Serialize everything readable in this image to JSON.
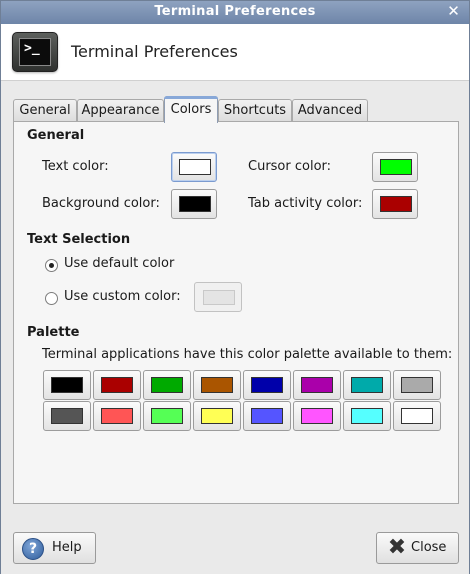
{
  "window": {
    "title": "Terminal Preferences"
  },
  "header": {
    "title": "Terminal Preferences",
    "icon": "terminal-app-icon",
    "prompt": ">_"
  },
  "tabs": [
    {
      "label": "General",
      "active": false
    },
    {
      "label": "Appearance",
      "active": false
    },
    {
      "label": "Colors",
      "active": true
    },
    {
      "label": "Shortcuts",
      "active": false
    },
    {
      "label": "Advanced",
      "active": false
    }
  ],
  "general": {
    "heading": "General",
    "text_color": {
      "label": "Text color:",
      "value": "#ffffff"
    },
    "cursor_color": {
      "label": "Cursor color:",
      "value": "#00ff00"
    },
    "background_color": {
      "label": "Background color:",
      "value": "#000000"
    },
    "tab_activity_color": {
      "label": "Tab activity color:",
      "value": "#aa0000"
    }
  },
  "text_selection": {
    "heading": "Text Selection",
    "use_default_label": "Use default color",
    "use_default_selected": true,
    "use_custom_label": "Use custom color:",
    "custom_value": "#e4e4e4"
  },
  "palette": {
    "heading": "Palette",
    "description": "Terminal applications have this color palette available to them:",
    "row1": [
      "#000000",
      "#aa0000",
      "#00aa00",
      "#aa5500",
      "#0000aa",
      "#aa00aa",
      "#00aaaa",
      "#aaaaaa"
    ],
    "row2": [
      "#555555",
      "#ff5555",
      "#55ff55",
      "#ffff55",
      "#5555ff",
      "#ff55ff",
      "#55ffff",
      "#ffffff"
    ]
  },
  "buttons": {
    "help": "Help",
    "close": "Close"
  }
}
